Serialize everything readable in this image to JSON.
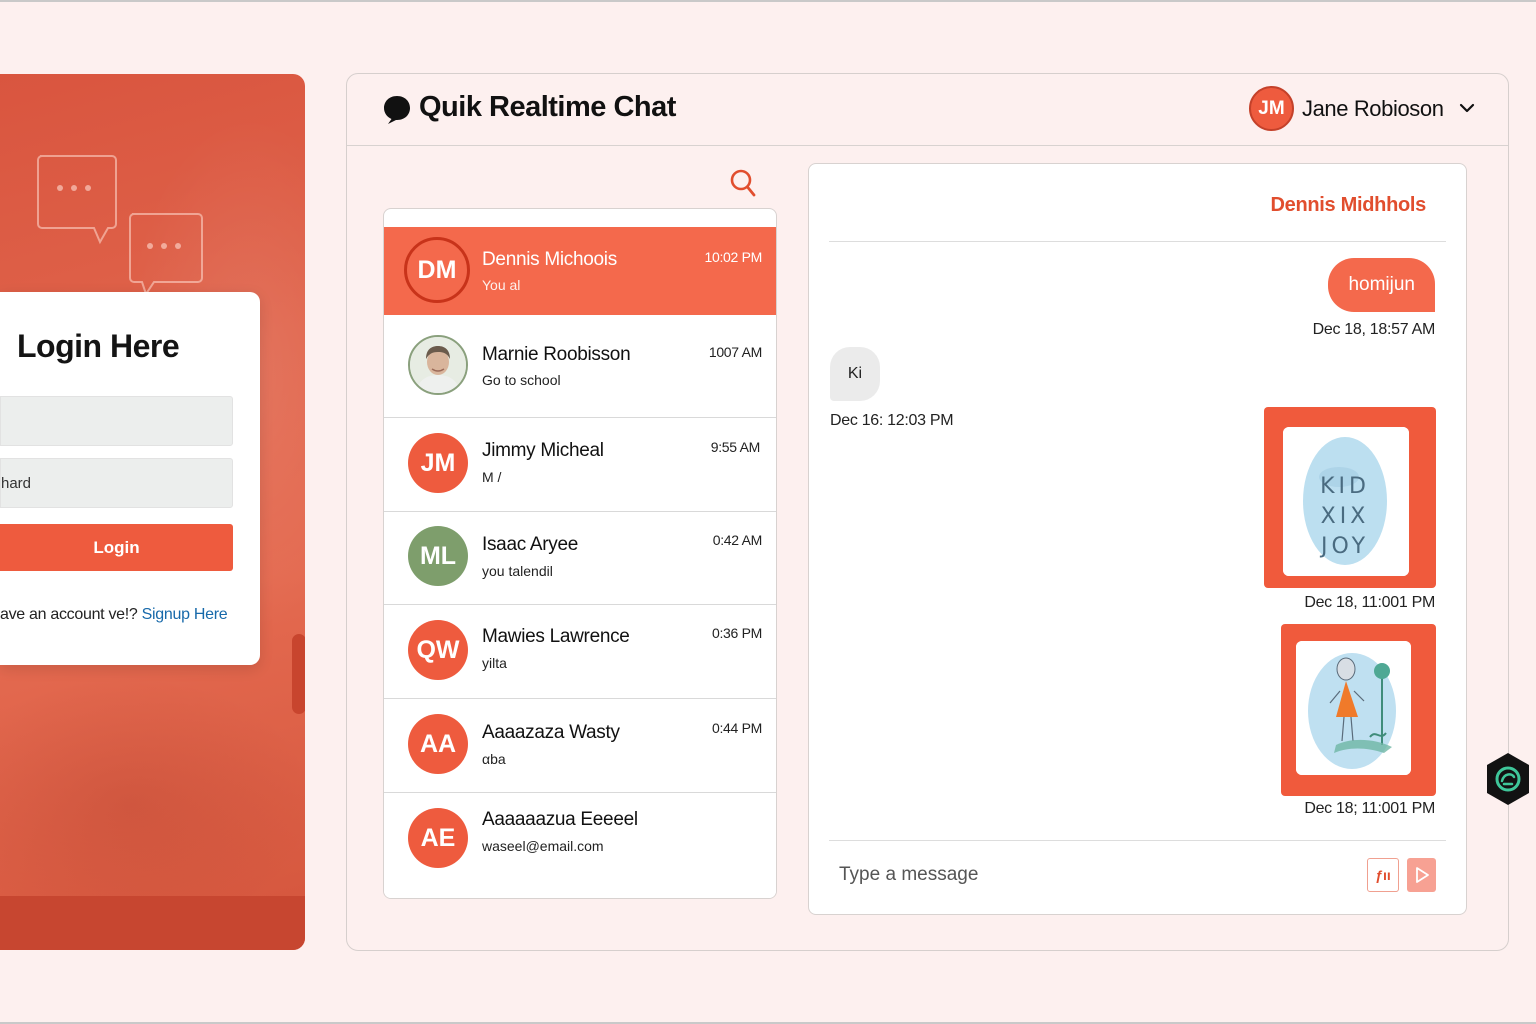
{
  "colors": {
    "accent": "#ee5b3e",
    "accent_dark": "#c8331a",
    "link": "#1769aa",
    "background": "#fdf0ef"
  },
  "login": {
    "title": "Login Here",
    "username_value": "",
    "password_value": "hard",
    "button_label": "Login",
    "footer_text": "ave an account ve!? ",
    "signup_link": "Signup Here"
  },
  "header": {
    "app_title": "Quik Realtime Chat",
    "app_icon": "chat-bubble-icon",
    "user_initials": "JM",
    "user_name": "Jane Robioson"
  },
  "search": {
    "icon": "search-icon"
  },
  "conversations": [
    {
      "initials": "DM",
      "name": "Dennis Michoois",
      "preview": "You al",
      "time": "10:02 PM",
      "active": true,
      "avatar": "initials"
    },
    {
      "initials": "",
      "name": "Marnie Roobisson",
      "preview": "Go to school",
      "time": "1007 AM",
      "active": false,
      "avatar": "photo"
    },
    {
      "initials": "JM",
      "name": "Jimmy Micheal",
      "preview": "M /",
      "time": "9:55 AM",
      "active": false,
      "avatar": "initials"
    },
    {
      "initials": "ML",
      "name": "Isaac Aryee",
      "preview": "you talendil",
      "time": "0:42 AM",
      "active": false,
      "avatar": "initials-green"
    },
    {
      "initials": "QW",
      "name": "Mawies Lawrence",
      "preview": "yilta",
      "time": "0:36 PM",
      "active": false,
      "avatar": "initials"
    },
    {
      "initials": "AA",
      "name": "Aaaazaza Wasty",
      "preview": "αba",
      "time": "0:44 PM",
      "active": false,
      "avatar": "initials"
    },
    {
      "initials": "AE",
      "name": "Aaaaaazua Eeeeel",
      "preview": "waseel@email.com",
      "time": "",
      "active": false,
      "avatar": "initials"
    }
  ],
  "chat": {
    "contact_name": "Dennis Midhhols",
    "messages": [
      {
        "direction": "out",
        "type": "text",
        "text": "homijun",
        "timestamp": "Dec 18, 18:57 AM"
      },
      {
        "direction": "in",
        "type": "text",
        "text": "Ki",
        "timestamp": "Dec 16: 12:03 PM"
      },
      {
        "direction": "out",
        "type": "image",
        "image_text": "KID XIX JOY",
        "timestamp": "Dec 18, 11:001 PM"
      },
      {
        "direction": "out",
        "type": "image",
        "image_text": "",
        "timestamp": "Dec 18; 11:001 PM"
      }
    ],
    "compose_placeholder": "Type a message",
    "emoji_button_label": "ƒıı",
    "send_icon": "send-icon"
  },
  "floating_badge_icon": "extension-badge-icon"
}
